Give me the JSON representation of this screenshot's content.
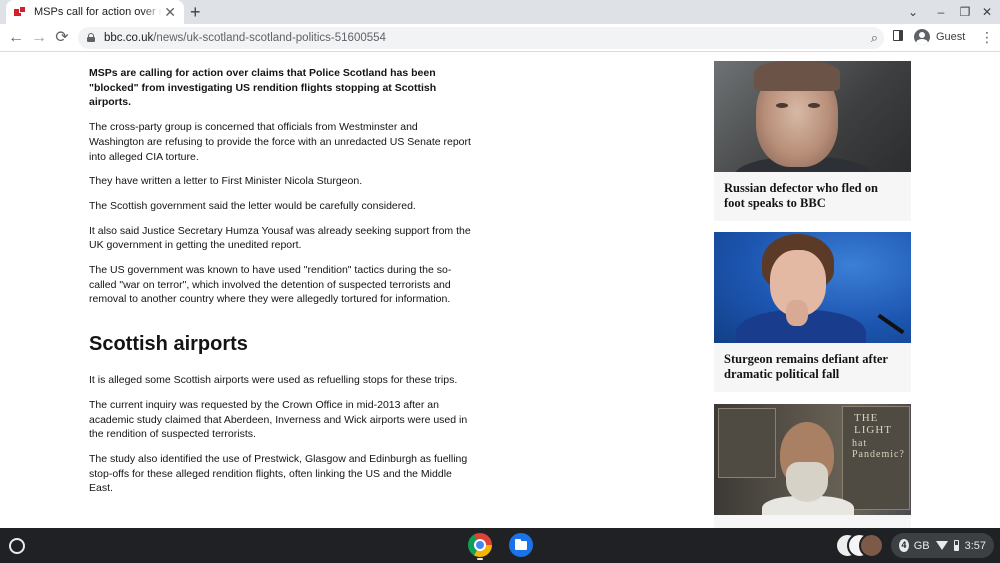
{
  "browser": {
    "tab": {
      "title": "MSPs call for action over rendition",
      "close": "✕"
    },
    "new_tab": "+",
    "window": {
      "tab_search": "⌄",
      "minimize": "–",
      "maximize": "❐",
      "close": "✕"
    },
    "nav": {
      "back": "←",
      "forward": "→",
      "reload": "⟳"
    },
    "url": {
      "domain": "bbc.co.uk",
      "path": "/news/uk-scotland-scotland-politics-51600554"
    },
    "zoom": "⌕",
    "profile_name": "Guest",
    "menu": "⋮"
  },
  "article": {
    "lead": "MSPs are calling for action over claims that Police Scotland has been \"blocked\" from investigating US rendition flights stopping at Scottish airports.",
    "paragraphs_1": [
      "The cross-party group is concerned that officials from Westminster and Washington are refusing to provide the force with an unredacted US Senate report into alleged CIA torture.",
      "They have written a letter to First Minister Nicola Sturgeon.",
      "The Scottish government said the letter would be carefully considered.",
      "It also said Justice Secretary Humza Yousaf was already seeking support from the UK government in getting the unedited report.",
      "The US government was known to have used \"rendition\" tactics during the so-called \"war on terror\", which involved the detention of suspected terrorists and removal to another country where they were allegedly tortured for information."
    ],
    "subheading": "Scottish airports",
    "paragraphs_2": [
      "It is alleged some Scottish airports were used as refuelling stops for these trips.",
      "The current inquiry was requested by the Crown Office in mid-2013 after an academic study claimed that Aberdeen, Inverness and Wick airports were used in the rendition of suspected terrorists.",
      "The study also identified the use of Prestwick, Glasgow and Edinburgh as fuelling stop-offs for these alleged rendition flights, often linking the US and the Middle East."
    ]
  },
  "sidebar": {
    "cards": [
      {
        "caption": "Russian defector who fled on foot speaks to BBC"
      },
      {
        "caption": "Sturgeon remains defiant after dramatic political fall"
      },
      {
        "caption": "",
        "poster_text_1": "THE LIGHT",
        "poster_text_2": "hat Pandemic?"
      }
    ]
  },
  "shelf": {
    "notification_count": "4",
    "tray_label": "GB",
    "time": "3:57"
  }
}
